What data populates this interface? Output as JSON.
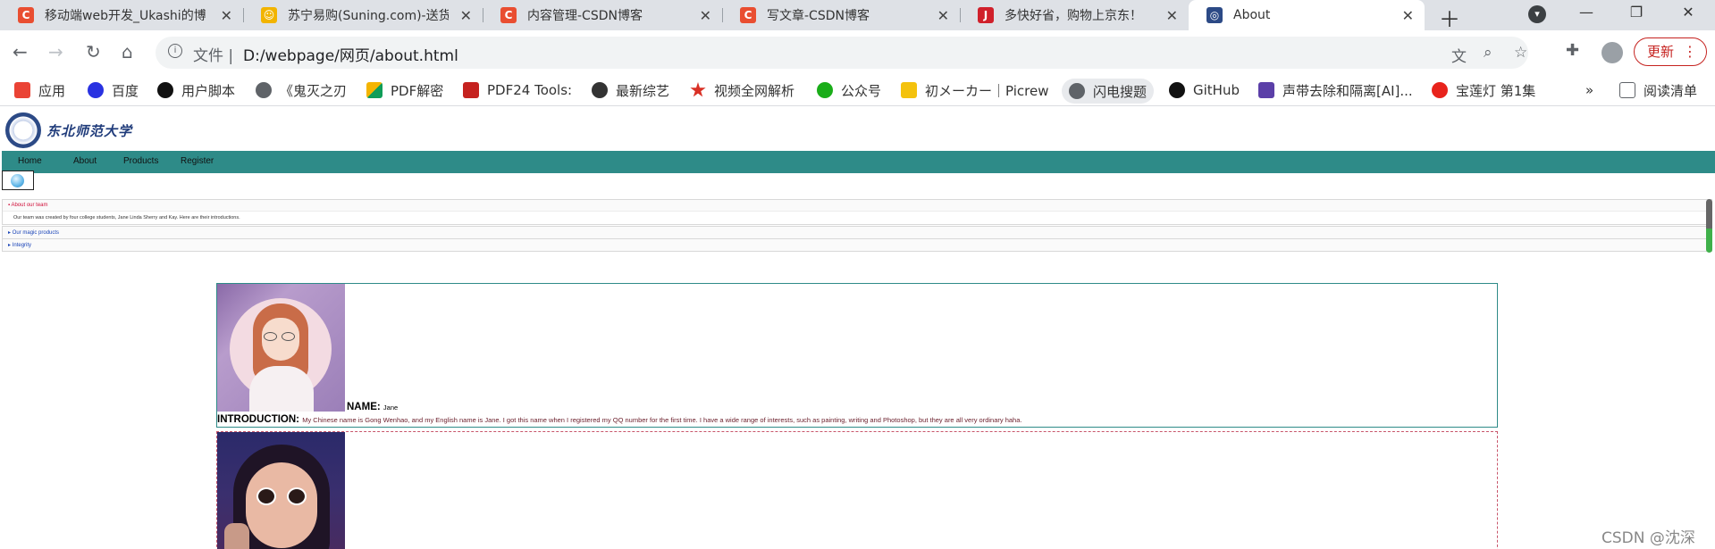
{
  "tabs": [
    {
      "title": "移动端web开发_Ukashi的博",
      "favicon_color": "#e94e31",
      "favicon_glyph": "C"
    },
    {
      "title": "苏宁易购(Suning.com)-送货",
      "favicon_color": "#f2b400",
      "favicon_glyph": "☺"
    },
    {
      "title": "内容管理-CSDN博客",
      "favicon_color": "#e94e31",
      "favicon_glyph": "C"
    },
    {
      "title": "写文章-CSDN博客",
      "favicon_color": "#e94e31",
      "favicon_glyph": "C"
    },
    {
      "title": "多快好省，购物上京东！",
      "favicon_color": "#d0202b",
      "favicon_glyph": "J"
    },
    {
      "title": "About",
      "favicon_color": "#2c4a86",
      "favicon_glyph": "◎",
      "active": true
    }
  ],
  "address": {
    "scheme": "文件 |",
    "url": "D:/webpage/网页/about.html"
  },
  "toolbar": {
    "update_label": "更新"
  },
  "bookmarks": [
    {
      "label": "应用",
      "color": "#ea4335"
    },
    {
      "label": "百度",
      "color": "#2932e1"
    },
    {
      "label": "用户脚本",
      "color": "#111111"
    },
    {
      "label": "《鬼灭之刃",
      "color": "#5f6368"
    },
    {
      "label": "PDF解密",
      "color": "#f4b400"
    },
    {
      "label": "PDF24 Tools:",
      "color": "#c5221f"
    },
    {
      "label": "最新综艺",
      "color": "#333333"
    },
    {
      "label": "视频全网解析",
      "color": "#d93025"
    },
    {
      "label": "公众号",
      "color": "#1aad19"
    },
    {
      "label": "初メーカー｜Picrew",
      "color": "#f4c20d"
    },
    {
      "label": "闪电搜题",
      "color": "#5f6368"
    },
    {
      "label": "GitHub",
      "color": "#111111"
    },
    {
      "label": "声带去除和隔离[AI]...",
      "color": "#5b3fa8"
    },
    {
      "label": "宝莲灯 第1集",
      "color": "#e8231c"
    }
  ],
  "reading_list": "阅读清单",
  "more_bookmarks": "»",
  "site": {
    "logo_text": "东北师范大学",
    "nav": [
      "Home",
      "About",
      "Products",
      "Register"
    ]
  },
  "accordion": [
    {
      "title": "About our team",
      "open": true,
      "body": "Our team was created by four college students, Jane Linda Sherry and Kay. Here are their introductions."
    },
    {
      "title": "Our magic products",
      "open": false
    },
    {
      "title": "Integrity",
      "open": false
    }
  ],
  "members": [
    {
      "name_label": "NAME:",
      "name": "Jane",
      "intro_label": "INTRODUCTION:",
      "intro": "My Chinese name is Gong Wenhao, and my English name is Jane. I got this name when I registered my QQ number for the first time. I have a wide range of interests, such as painting, writing and Photoshop, but they are all very ordinary haha."
    }
  ],
  "watermark": "CSDN @沈深"
}
